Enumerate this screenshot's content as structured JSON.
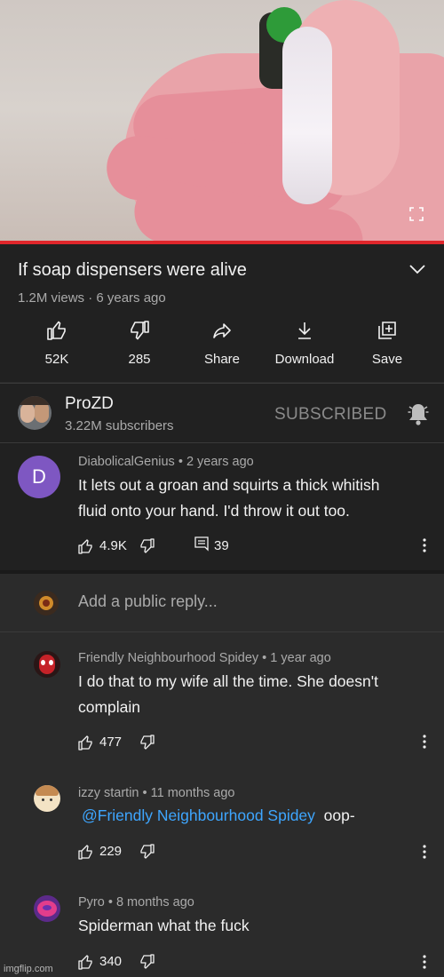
{
  "video": {
    "title": "If soap dispensers were alive",
    "meta": "1.2M views · 6 years ago",
    "progress_fraction": 1.0
  },
  "actions": [
    {
      "label": "52K",
      "icon": "thumbs-up-icon"
    },
    {
      "label": "285",
      "icon": "thumbs-down-icon"
    },
    {
      "label": "Share",
      "icon": "share-icon"
    },
    {
      "label": "Download",
      "icon": "download-icon"
    },
    {
      "label": "Save",
      "icon": "save-to-playlist-icon"
    }
  ],
  "channel": {
    "name": "ProZD",
    "subscribers": "3.22M subscribers",
    "subscribe_state": "SUBSCRIBED"
  },
  "top_comment": {
    "avatar_letter": "D",
    "author": "DiabolicalGenius",
    "time": "2 years ago",
    "text_line1": "It lets out a groan and squirts a thick whitish",
    "text_line2": "fluid onto your hand. I'd throw it out too.",
    "likes": "4.9K",
    "replies": "39"
  },
  "reply_input": {
    "placeholder": "Add a public reply..."
  },
  "replies": [
    {
      "author": "Friendly Neighbourhood Spidey",
      "time": "1 year ago",
      "text_line1": "I do that to my wife all the time. She doesn't",
      "text_line2": "complain",
      "likes": "477"
    },
    {
      "author": "izzy startin",
      "time": "11 months ago",
      "mention": "@Friendly Neighbourhood Spidey",
      "text": "oop-",
      "likes": "229"
    },
    {
      "author": "Pyro",
      "time": "8 months ago",
      "text_line1": "Spiderman what the fuck",
      "likes": "340"
    }
  ],
  "watermark": "imgflip.com",
  "colors": {
    "accent_red": "#e0262b",
    "mention_blue": "#3ea6ff",
    "avatar_purple": "#7e57c2"
  }
}
